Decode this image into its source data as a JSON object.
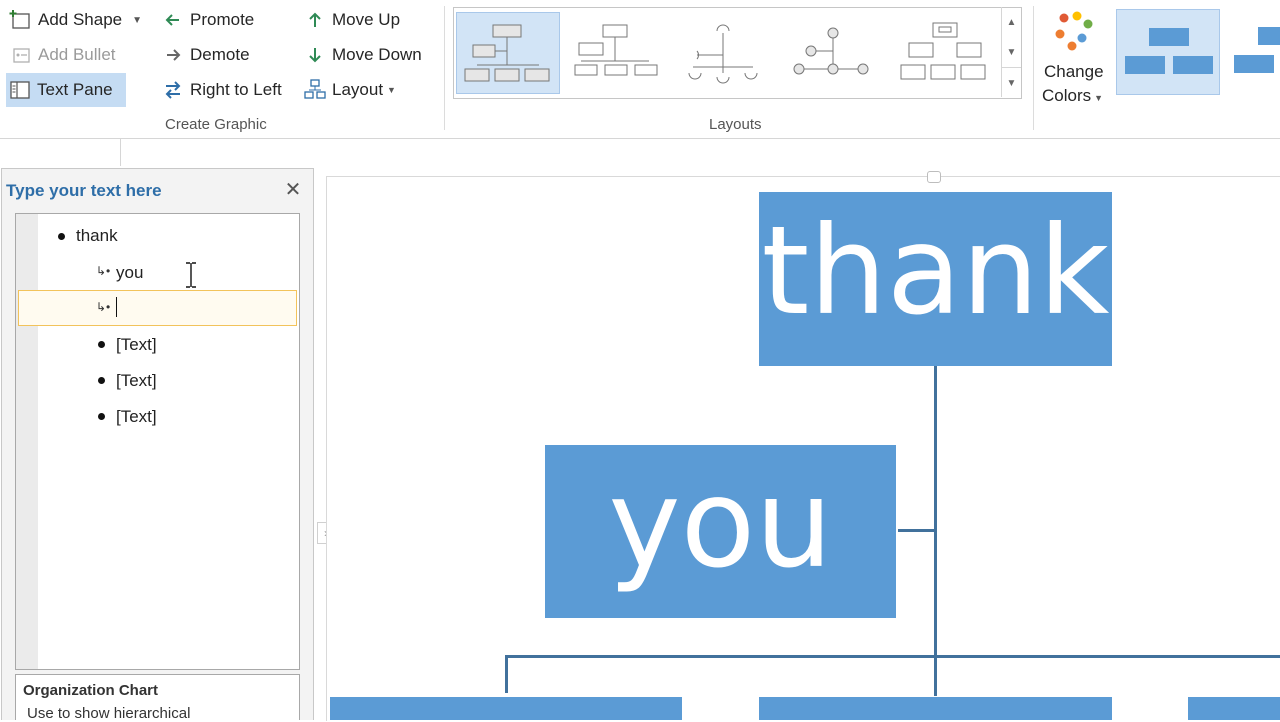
{
  "ribbon": {
    "create_graphic": {
      "add_shape": "Add Shape",
      "add_bullet": "Add Bullet",
      "text_pane": "Text Pane",
      "promote": "Promote",
      "demote": "Demote",
      "right_to_left": "Right to Left",
      "move_up": "Move Up",
      "move_down": "Move Down",
      "layout": "Layout",
      "label": "Create Graphic"
    },
    "layouts": {
      "label": "Layouts"
    },
    "change_colors": {
      "line1": "Change",
      "line2": "Colors"
    },
    "colors": {
      "accent_blue": "#5b9bd5",
      "dot_orange": "#ed7d31",
      "dot_yellow": "#ffc000",
      "dot_blue": "#5b9bd5",
      "dot_green": "#70ad47",
      "dot_red": "#e05a35"
    }
  },
  "text_pane": {
    "title": "Type your text here",
    "items": [
      {
        "text": "thank"
      },
      {
        "text": "you"
      },
      {
        "text": ""
      },
      {
        "text": "[Text]"
      },
      {
        "text": "[Text]"
      },
      {
        "text": "[Text]"
      }
    ],
    "description_title": "Organization Chart",
    "description_body": "Use to show hierarchical"
  },
  "canvas": {
    "box_top": "thank",
    "box_second": "you"
  }
}
